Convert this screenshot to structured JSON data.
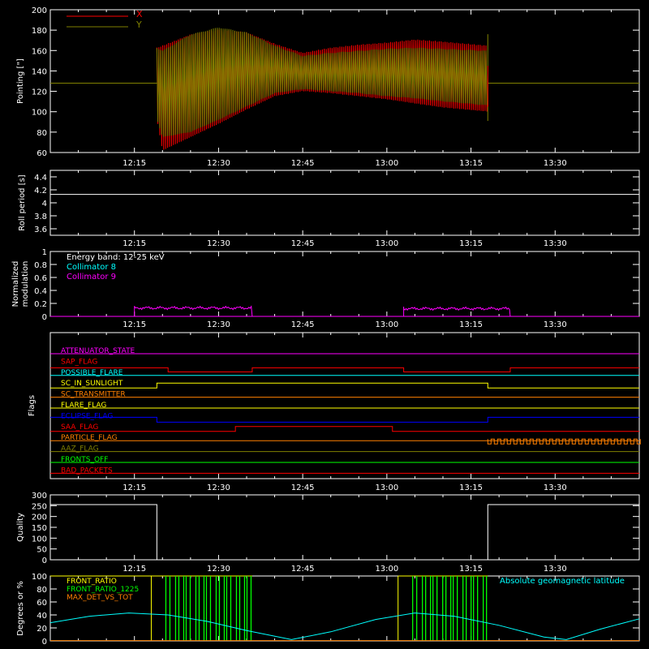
{
  "colors": {
    "axis": "#ffffff",
    "x": "#ff0000",
    "y": "#808000",
    "cyan": "#00ffff",
    "magenta": "#ff00ff",
    "yellow": "#ffff00",
    "green": "#00ff00",
    "orange": "#ff8000",
    "blue": "#0000ff"
  },
  "time_ticks": [
    "12:15",
    "12:30",
    "12:45",
    "13:00",
    "13:15",
    "13:30"
  ],
  "chart_data": [
    {
      "type": "line",
      "id": "pointing",
      "ylabel": "Pointing [\"]",
      "ylim": [
        60,
        200
      ],
      "yticks": [
        60,
        80,
        100,
        120,
        140,
        160,
        180,
        200
      ],
      "xlim": [
        "12:00",
        "13:45"
      ],
      "legend_placement": "top-left",
      "series": [
        {
          "name": "X",
          "color": "#ff0000",
          "x_start": "12:19",
          "x_end": "13:18",
          "envelope": [
            {
              "t": "12:19",
              "upper": 163,
              "lower": 93
            },
            {
              "t": "12:20",
              "upper": 165,
              "lower": 62
            },
            {
              "t": "12:25",
              "upper": 176,
              "lower": 75
            },
            {
              "t": "12:30",
              "upper": 181,
              "lower": 88
            },
            {
              "t": "12:35",
              "upper": 178,
              "lower": 102
            },
            {
              "t": "12:40",
              "upper": 167,
              "lower": 115
            },
            {
              "t": "12:45",
              "upper": 158,
              "lower": 120
            },
            {
              "t": "12:50",
              "upper": 163,
              "lower": 118
            },
            {
              "t": "12:55",
              "upper": 166,
              "lower": 115
            },
            {
              "t": "13:00",
              "upper": 168,
              "lower": 112
            },
            {
              "t": "13:05",
              "upper": 171,
              "lower": 108
            },
            {
              "t": "13:10",
              "upper": 169,
              "lower": 104
            },
            {
              "t": "13:18",
              "upper": 165,
              "lower": 100
            }
          ]
        },
        {
          "name": "Y",
          "color": "#808000",
          "baseline": 128,
          "x_start": "12:19",
          "x_end": "13:18",
          "envelope": [
            {
              "t": "12:19",
              "upper": 163,
              "lower": 93
            },
            {
              "t": "12:20",
              "upper": 160,
              "lower": 75
            },
            {
              "t": "12:25",
              "upper": 176,
              "lower": 80
            },
            {
              "t": "12:30",
              "upper": 183,
              "lower": 92
            },
            {
              "t": "12:35",
              "upper": 178,
              "lower": 105
            },
            {
              "t": "12:40",
              "upper": 165,
              "lower": 118
            },
            {
              "t": "12:45",
              "upper": 155,
              "lower": 122
            },
            {
              "t": "12:50",
              "upper": 158,
              "lower": 120
            },
            {
              "t": "12:55",
              "upper": 160,
              "lower": 118
            },
            {
              "t": "13:00",
              "upper": 162,
              "lower": 115
            },
            {
              "t": "13:05",
              "upper": 163,
              "lower": 113
            },
            {
              "t": "13:10",
              "upper": 162,
              "lower": 110
            },
            {
              "t": "13:18",
              "upper": 160,
              "lower": 106
            }
          ]
        }
      ]
    },
    {
      "type": "line",
      "id": "roll",
      "ylabel": "Roll period [s]",
      "ylim": [
        3.5,
        4.5
      ],
      "yticks": [
        3.6,
        3.8,
        4.0,
        4.2,
        4.4
      ],
      "series": [
        {
          "name": "",
          "color": "#ffffff",
          "value": 4.13
        }
      ]
    },
    {
      "type": "line",
      "id": "modulation",
      "ylabel": "Normalized modulation",
      "ylim": [
        0,
        1.0
      ],
      "yticks": [
        0.0,
        0.2,
        0.4,
        0.6,
        0.8,
        1.0
      ],
      "legend": [
        "Energy band: 12-25 keV",
        "Collimator 8",
        "Collimator 9"
      ],
      "legend_colors": [
        "#ffffff",
        "#00ffff",
        "#ff00ff"
      ],
      "segments": [
        {
          "start": "12:15",
          "end": "12:36",
          "value": 0.13
        },
        {
          "start": "13:03",
          "end": "13:22",
          "value": 0.12
        }
      ]
    },
    {
      "type": "step",
      "id": "flags",
      "ylabel": "Flags",
      "flags": [
        {
          "name": "ATTENUATOR_STATE",
          "color": "#ff00ff",
          "changes": []
        },
        {
          "name": "SAP_FLAG",
          "color": "#ff0000",
          "changes": [
            {
              "start": "12:21",
              "end": "12:36"
            },
            {
              "start": "13:03",
              "end": "13:22"
            }
          ],
          "high_outside": true
        },
        {
          "name": "POSSIBLE_FLARE",
          "color": "#00ffff",
          "changes": []
        },
        {
          "name": "SC_IN_SUNLIGHT",
          "color": "#ffff00",
          "changes": [
            {
              "start": "12:19",
              "end": "13:18"
            }
          ]
        },
        {
          "name": "SC_TRANSMITTER",
          "color": "#ff8000",
          "changes": []
        },
        {
          "name": "FLARE_FLAG",
          "color": "#ffff00",
          "changes": []
        },
        {
          "name": "ECLIPSE_FLAG",
          "color": "#0000ff",
          "changes": [
            {
              "start": "12:19",
              "end": "13:18"
            }
          ],
          "low_inside": true
        },
        {
          "name": "SAA_FLAG",
          "color": "#ff0000",
          "changes": [
            {
              "start": "12:33",
              "end": "13:01"
            }
          ]
        },
        {
          "name": "PARTICLE_FLAG",
          "color": "#ff8000",
          "changes": []
        },
        {
          "name": "AAZ_FLAG",
          "color": "#808000",
          "changes": []
        },
        {
          "name": "FRONTS_OFF",
          "color": "#00ff00",
          "changes": []
        },
        {
          "name": "BAD_PACKETS",
          "color": "#ff0000",
          "changes": []
        }
      ]
    },
    {
      "type": "line",
      "id": "quality",
      "ylabel": "Quality",
      "ylim": [
        0,
        300
      ],
      "yticks": [
        0,
        50,
        100,
        150,
        200,
        250,
        300
      ],
      "series": [
        {
          "name": "",
          "color": "#ffffff",
          "high": 255,
          "low_start": "12:19",
          "low_end": "13:18"
        }
      ]
    },
    {
      "type": "line",
      "id": "latitude",
      "ylabel": "Degrees or %",
      "ylim": [
        0,
        100
      ],
      "yticks": [
        0,
        20,
        40,
        60,
        80,
        100
      ],
      "legend": [
        "FRONT_RATIO",
        "FRONT_RATIO_1225",
        "MAX_DET_VS_TOT"
      ],
      "legend_colors": [
        "#ffff00",
        "#00ff00",
        "#ff8000"
      ],
      "right_label": "Absolute geomagnetic latitude",
      "right_label_color": "#00ffff",
      "latitude_curve": [
        {
          "t": "12:00",
          "v": 28
        },
        {
          "t": "12:07",
          "v": 38
        },
        {
          "t": "12:14",
          "v": 43
        },
        {
          "t": "12:21",
          "v": 40
        },
        {
          "t": "12:28",
          "v": 30
        },
        {
          "t": "12:35",
          "v": 16
        },
        {
          "t": "12:43",
          "v": 2
        },
        {
          "t": "12:50",
          "v": 14
        },
        {
          "t": "12:58",
          "v": 33
        },
        {
          "t": "13:05",
          "v": 43
        },
        {
          "t": "13:12",
          "v": 38
        },
        {
          "t": "13:20",
          "v": 24
        },
        {
          "t": "13:28",
          "v": 6
        },
        {
          "t": "13:32",
          "v": 2
        },
        {
          "t": "13:38",
          "v": 18
        },
        {
          "t": "13:45",
          "v": 34
        }
      ]
    }
  ]
}
